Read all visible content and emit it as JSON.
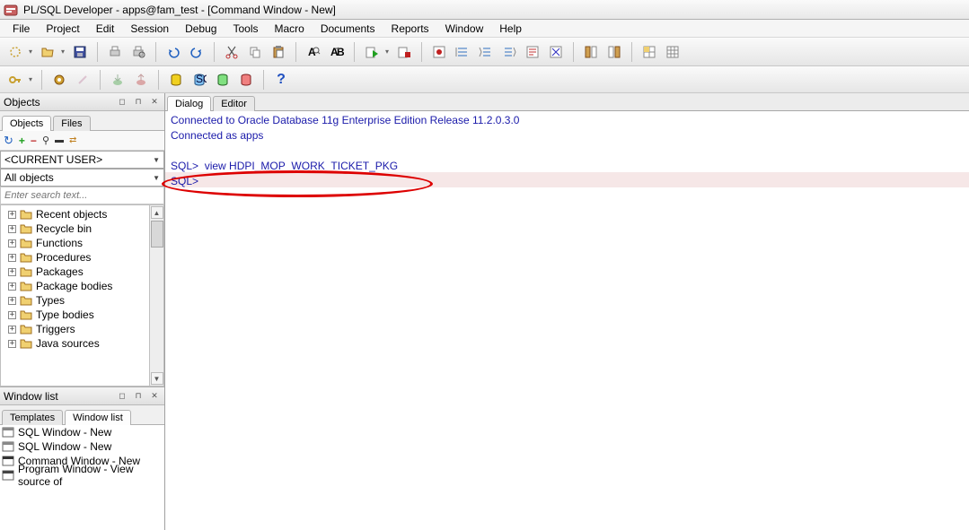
{
  "title": "PL/SQL Developer - apps@fam_test - [Command Window - New]",
  "menus": [
    "File",
    "Project",
    "Edit",
    "Session",
    "Debug",
    "Tools",
    "Macro",
    "Documents",
    "Reports",
    "Window",
    "Help"
  ],
  "sidebar": {
    "objects_panel": {
      "title": "Objects",
      "tabs": [
        "Objects",
        "Files"
      ],
      "user_combo": "<CURRENT USER>",
      "filter_combo": "All objects",
      "search_placeholder": "Enter search text...",
      "tree": [
        "Recent objects",
        "Recycle bin",
        "Functions",
        "Procedures",
        "Packages",
        "Package bodies",
        "Types",
        "Type bodies",
        "Triggers",
        "Java sources"
      ]
    },
    "windows_panel": {
      "title": "Window list",
      "tabs": [
        "Templates",
        "Window list"
      ],
      "items": [
        "SQL Window - New",
        "SQL Window - New",
        "Command Window - New",
        "Program Window - View source of"
      ]
    }
  },
  "editor": {
    "tabs": [
      "Dialog",
      "Editor"
    ],
    "console": {
      "line1": "Connected to Oracle Database 11g Enterprise Edition Release 11.2.0.3.0",
      "line2": "Connected as apps",
      "sql_prompt_1": "SQL>",
      "sql_command": "view HDPI_MOP_WORK_TICKET_PKG",
      "sql_prompt_2": "SQL>"
    }
  }
}
